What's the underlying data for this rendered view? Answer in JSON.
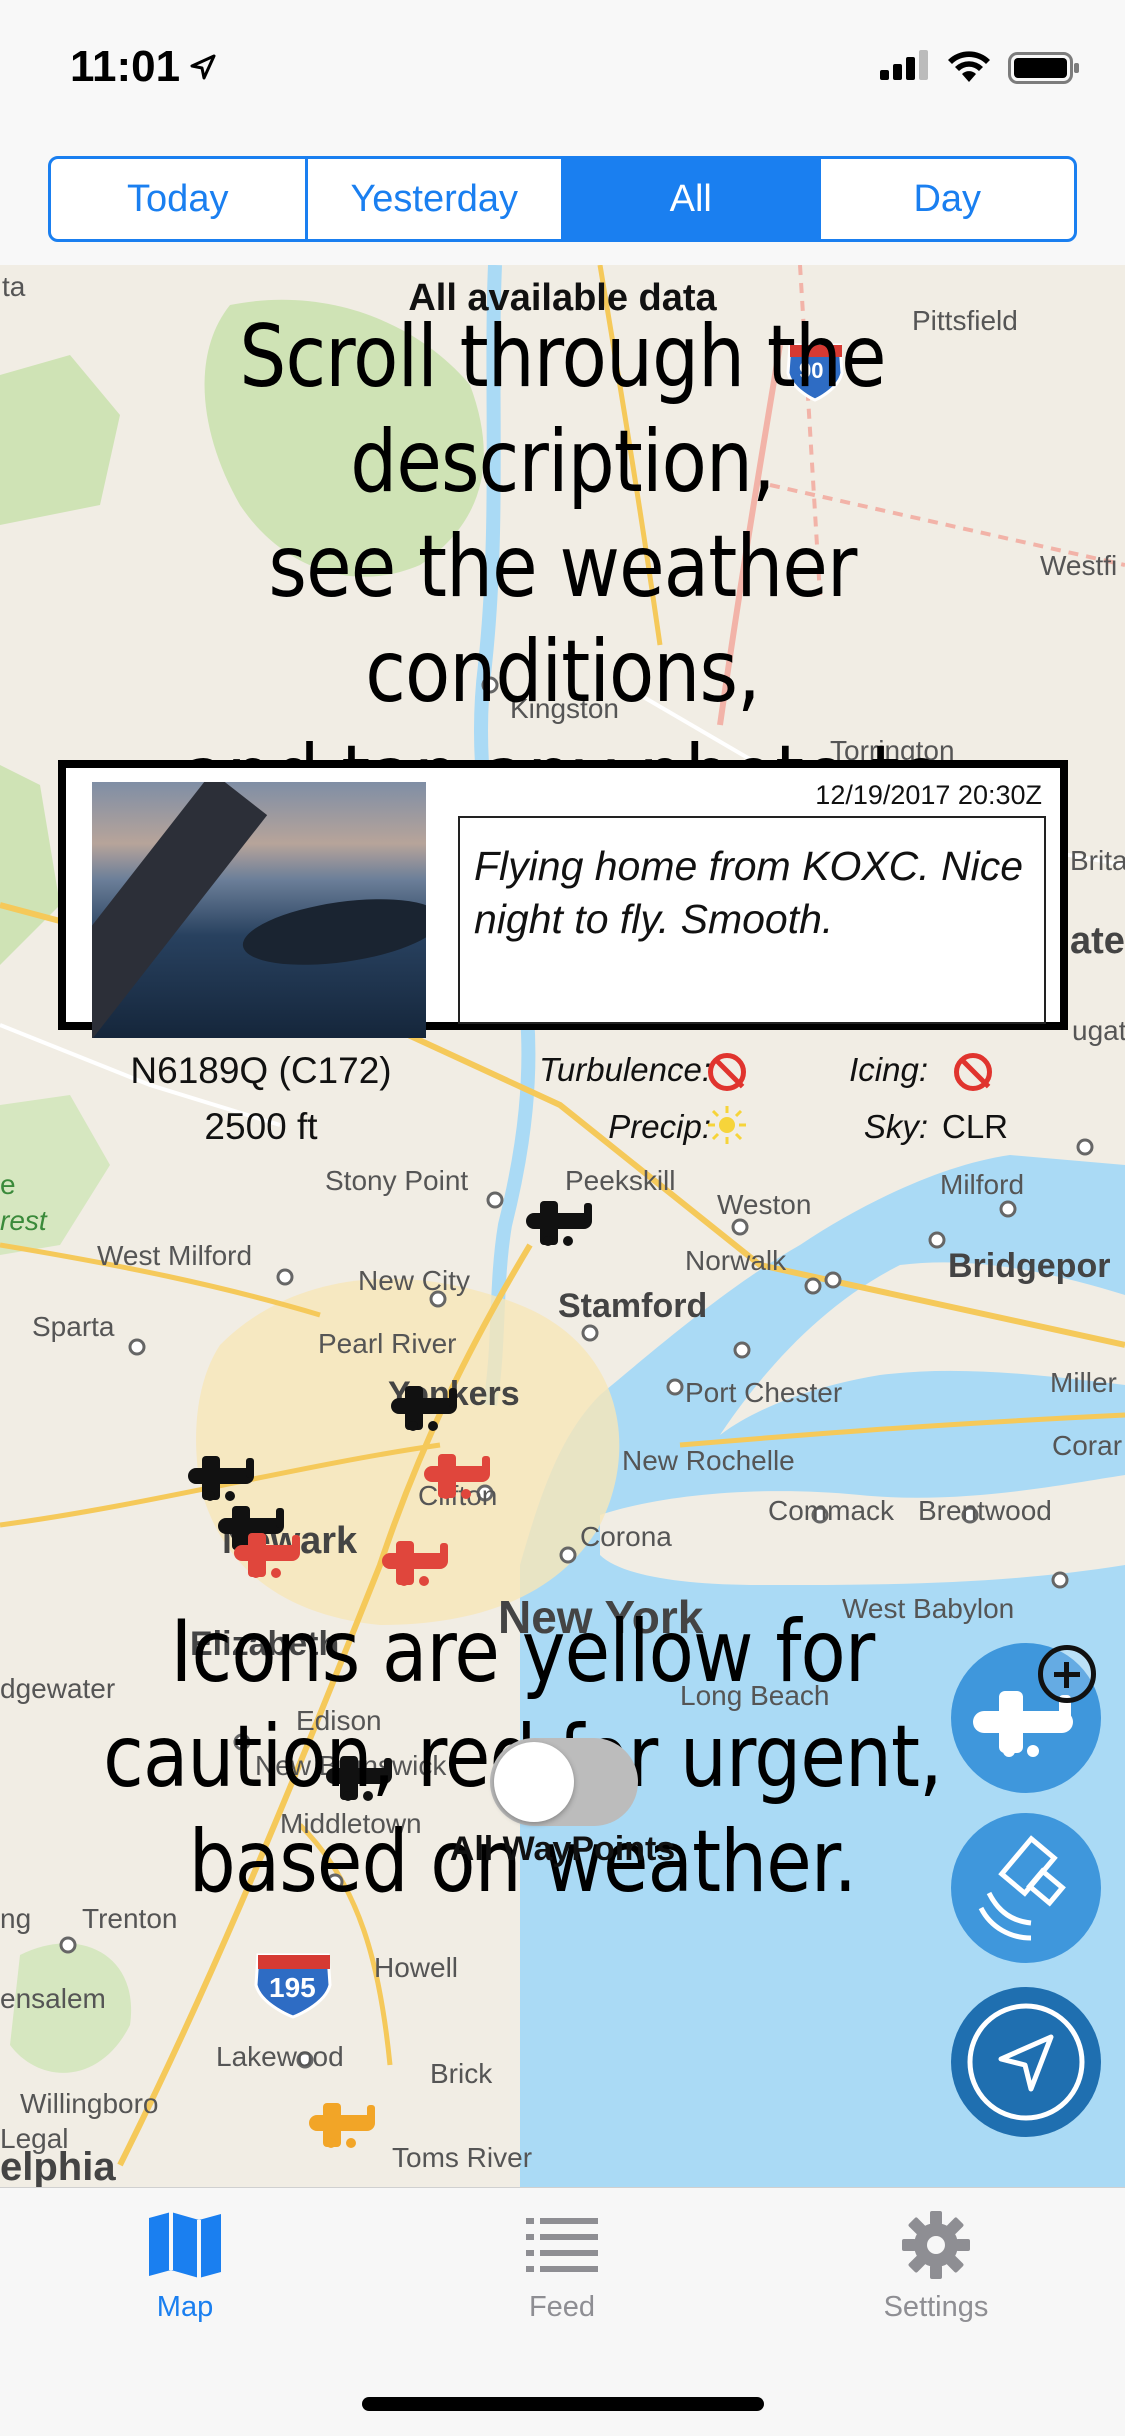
{
  "status_bar": {
    "time": "11:01"
  },
  "segments": [
    {
      "label": "Today",
      "active": false
    },
    {
      "label": "Yesterday",
      "active": false
    },
    {
      "label": "All",
      "active": true
    },
    {
      "label": "Day",
      "active": false
    }
  ],
  "map": {
    "header": "All available data",
    "labels": {
      "ta": "ta",
      "pittsfield": "Pittsfield",
      "westfi": "Westfi",
      "kingston": "Kingston",
      "torrington": "Torrington",
      "brita": "Brita",
      "ate": "ate",
      "ugat": "ugat",
      "stony_point": "Stony Point",
      "peekskill": "Peekskill",
      "weston": "Weston",
      "milford": "Milford",
      "e": "e",
      "rest": "rest",
      "west_milford": "West Milford",
      "norwalk": "Norwalk",
      "bridgeport": "Bridgepor",
      "new_city": "New City",
      "stamford": "Stamford",
      "sparta": "Sparta",
      "pearl_river": "Pearl River",
      "yonkers": "Yonkers",
      "port_chester": "Port Chester",
      "miller": "Miller",
      "corar": "Corar",
      "new_rochelle": "New Rochelle",
      "clifton": "Clifton",
      "commack": "Commack",
      "brentwood": "Brentwood",
      "newark": "Newark",
      "corona": "Corona",
      "new_york": "New York",
      "west_babylon": "West Babylon",
      "elizabeth": "Elizabeth",
      "edison": "Edison",
      "long_beach": "Long Beach",
      "dgewater": "dgewater",
      "new_brunswick": "New Brunswick",
      "middletown": "Middletown",
      "ng": "ng",
      "trenton": "Trenton",
      "howell": "Howell",
      "ensalem": "ensalem",
      "lakewood": "Lakewood",
      "brick": "Brick",
      "willingboro": "Willingboro",
      "legal": "Legal",
      "elphia": "elphia",
      "toms_river": "Toms River",
      "shield_90": "90",
      "shield_195": "195"
    }
  },
  "overlay_text": {
    "top": [
      "Scroll through the description,",
      "see the weather conditions,",
      "and tap any photo to enlarge."
    ],
    "bottom": [
      "Icons are yellow for",
      "caution, red for urgent,",
      "based on weather."
    ]
  },
  "card": {
    "timestamp": "12/19/2017 20:30Z",
    "description": "Flying home from KOXC. Nice night to fly. Smooth.",
    "aircraft": "N6189Q (C172)",
    "altitude": "2500 ft",
    "turbulence_label": "Turbulence:",
    "icing_label": "Icing:",
    "precip_label": "Precip:",
    "sky_label": "Sky:",
    "sky_value": "CLR",
    "turbulence_icon": "no-symbol-icon",
    "icing_icon": "no-symbol-icon",
    "precip_icon": "sun-icon"
  },
  "toggle": {
    "label": "All WayPoints",
    "on": false
  },
  "tabs": [
    {
      "label": "Map",
      "icon": "map-icon",
      "active": true
    },
    {
      "label": "Feed",
      "icon": "list-icon",
      "active": false
    },
    {
      "label": "Settings",
      "icon": "gear-icon",
      "active": false
    }
  ],
  "colors": {
    "accent": "#1a7ff0",
    "fab_blue": "#3f97dc",
    "fab_dark": "#1f6fb0",
    "plane_red": "#e0463c",
    "plane_yellow": "#f2a527",
    "plane_black": "#111111",
    "water": "#aadaf5"
  }
}
